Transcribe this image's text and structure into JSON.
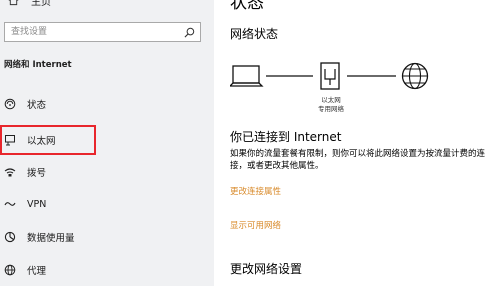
{
  "sidebar": {
    "home_label": "主页",
    "search_placeholder": "查找设置",
    "section_title": "网络和 Internet",
    "items": [
      {
        "label": "状态",
        "icon": "status-icon"
      },
      {
        "label": "以太网",
        "icon": "ethernet-icon"
      },
      {
        "label": "拨号",
        "icon": "dialup-icon"
      },
      {
        "label": "VPN",
        "icon": "vpn-icon"
      },
      {
        "label": "数据使用量",
        "icon": "data-usage-icon"
      },
      {
        "label": "代理",
        "icon": "proxy-icon"
      }
    ]
  },
  "main": {
    "title": "状态",
    "network_status_heading": "网络状态",
    "diagram_label_line1": "以太网",
    "diagram_label_line2": "专用网络",
    "connected_heading": "你已连接到 Internet",
    "description": "如果你的流量套餐有限制，则你可以将此网络设置为按流量计费的连接，或者更改其他属性。",
    "link_change_properties": "更改连接属性",
    "link_show_networks": "显示可用网络",
    "change_settings_heading": "更改网络设置"
  },
  "colors": {
    "sidebar_bg": "#f0f1f3",
    "highlight_border": "#e8262c",
    "link": "#d88a2a"
  }
}
